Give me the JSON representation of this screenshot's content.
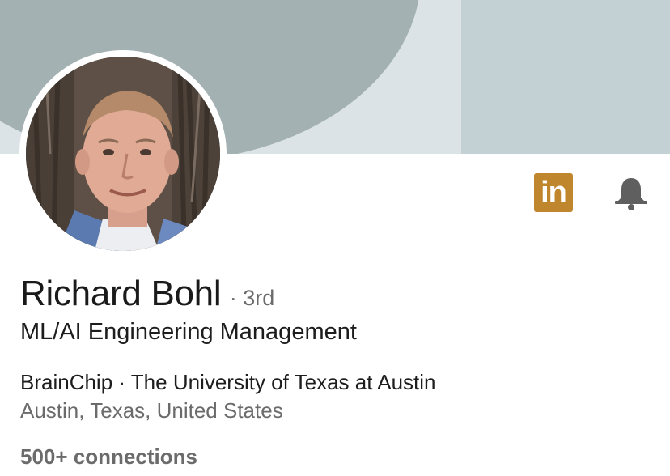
{
  "banner": {
    "colors": {
      "base": "#dce3e6",
      "shape_left": "#a3b1b3",
      "shape_right": "#c3d1d4"
    }
  },
  "profile": {
    "avatar": "profile-photo",
    "name": "Richard Bohl",
    "degree": "· 3rd",
    "headline": "ML/AI Engineering Management",
    "company_education": "BrainChip · The University of Texas at Austin",
    "location": "Austin, Texas, United States",
    "connections": "500+ connections"
  },
  "actions": {
    "linkedin_badge_text": "in",
    "linkedin_icon": "linkedin-icon",
    "bell_icon": "bell-icon"
  },
  "colors": {
    "linkedin_badge": "#c0862d",
    "bell": "#5f5f5f",
    "muted_text": "#6b6b6b"
  }
}
